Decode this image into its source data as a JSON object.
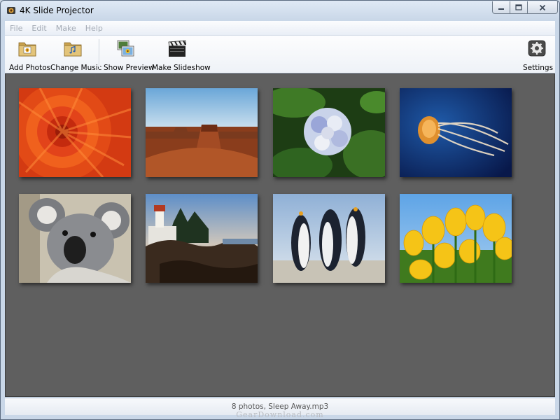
{
  "window": {
    "title": "4K Slide Projector",
    "controls": {
      "minimize": "minimize",
      "maximize": "maximize",
      "close": "close"
    }
  },
  "menu": [
    "File",
    "Edit",
    "Make",
    "Help"
  ],
  "toolbar": {
    "add_photos": "Add Photos",
    "change_music": "Change Music",
    "show_preview": "Show Preview",
    "make_slideshow": "Make Slideshow",
    "settings": "Settings"
  },
  "photos": [
    {
      "subject": "chrysanthemum",
      "icon": "flower"
    },
    {
      "subject": "desert",
      "icon": "landscape"
    },
    {
      "subject": "hydrangeas",
      "icon": "flower"
    },
    {
      "subject": "jellyfish",
      "icon": "animal"
    },
    {
      "subject": "koala",
      "icon": "animal"
    },
    {
      "subject": "lighthouse",
      "icon": "landscape"
    },
    {
      "subject": "penguins",
      "icon": "animal"
    },
    {
      "subject": "tulips",
      "icon": "flower"
    }
  ],
  "status": {
    "text": "8 photos, Sleep Away.mp3",
    "watermark": "GearDownload.com"
  },
  "colors": {
    "canvas_bg": "#5f5f5f",
    "window_frame": "#c9d7e8",
    "close_hover": "#c0392b"
  }
}
